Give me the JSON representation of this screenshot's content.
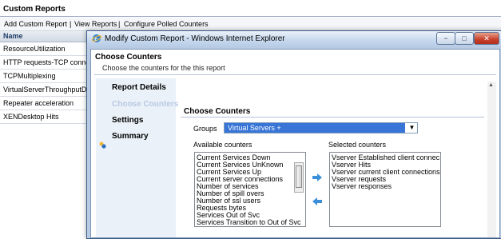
{
  "background": {
    "title": "Custom Reports",
    "toolbar": {
      "add": "Add Custom Report",
      "sep1": "|",
      "view": "View Reports",
      "sep2": "|",
      "configure": "Configure Polled Counters"
    },
    "column_header": "Name",
    "rows": [
      "ResourceUtilization",
      "HTTP requests-TCP conne",
      "TCPMultiplexing",
      "VirtualServerThroughputD",
      "Repeater acceleration",
      "XENDesktop Hits"
    ]
  },
  "dialog": {
    "title": "Modify Custom Report - Windows Internet Explorer",
    "heading": "Choose Counters",
    "subtitle": "Choose the counters for the this report",
    "window_buttons": {
      "minimize": "−",
      "maximize": "□",
      "close": "✕"
    },
    "nav": [
      "Report Details",
      "Choose Counters",
      "Settings",
      "Summary"
    ],
    "active_nav": "Choose Counters",
    "content": {
      "title": "Choose Counters",
      "groups_label": "Groups",
      "groups_value": "Virtual Servers +",
      "available_label": "Available counters",
      "selected_label": "Selected counters",
      "available": [
        "Current Services Down",
        "Current Services UnKnown",
        "Current Services Up",
        "Current server connections",
        "Number of services",
        "Number of spill overs",
        "Number of ssl users",
        "Requests bytes",
        "Services Out of Svc",
        "Services Transition to Out of Svc"
      ],
      "selected": [
        "Vserver Established client connec",
        "Vserver Hits",
        "Vserver current client connections",
        "Vserver requests",
        "Vserver responses"
      ]
    },
    "colors": {
      "accent": "#3875d7",
      "frame": "#b8cbe3",
      "nav_bg": "#eaf1f8",
      "arrow": "#3b8fd9"
    },
    "icons": [
      "ie-icon",
      "nav-marker-icon",
      "move-right-icon",
      "move-left-icon",
      "dropdown-arrow-icon",
      "scroll-up-icon"
    ]
  }
}
